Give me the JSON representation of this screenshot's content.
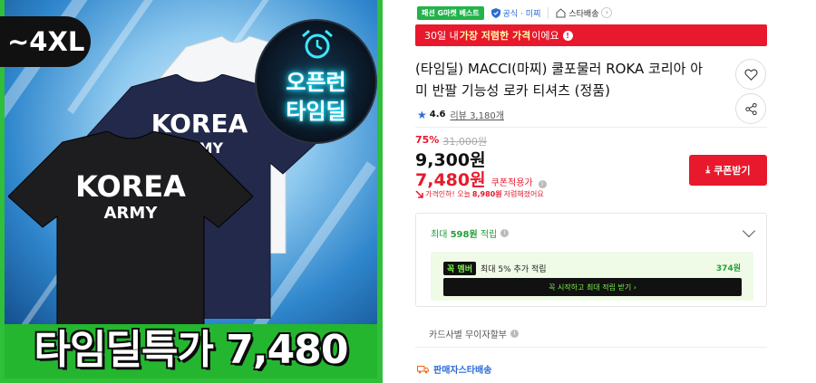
{
  "image": {
    "size_badge": "~4XL",
    "timer_badge": {
      "line1": "오픈런",
      "line2": "타임딜"
    },
    "tshirts": {
      "front_text1": "KOREA",
      "front_text2": "ARMY",
      "middle_text1": "KOREA",
      "middle_text2": "ARMY"
    },
    "deal_banner": "타임딜특가 7,480"
  },
  "badges": {
    "fashion_best": "패션 G마켓 베스트",
    "official": "공식 · 미찌",
    "star_delivery": "스타배송",
    "chevron": "›"
  },
  "price_alert": {
    "prefix": "30일 내 ",
    "highlight": "가장 저렴한 가격",
    "suffix": "이에요",
    "icon": "!"
  },
  "product": {
    "title_line1": "(타임딜) MACCI(마찌) 쿨포물러 ROKA 코리아 아",
    "title_line2": "미 반팔 기능성 로카 티셔츠 (정품)"
  },
  "rating": {
    "star": "★",
    "score": "4.6",
    "reviews": "리뷰 3,180개"
  },
  "price": {
    "discount_rate": "75%",
    "original": "31,000원",
    "sale": "9,300원",
    "coupon_price": "7,480원",
    "coupon_label": "쿠폰적용가",
    "lowest_note_prefix": "가격인하! 오늘 ",
    "lowest_note_amount": "8,980원",
    "lowest_note_suffix": " 저렴해졌어요"
  },
  "coupon_button": {
    "icon": "⤓",
    "label": "쿠폰받기"
  },
  "points": {
    "prefix": "최대 ",
    "amount": "598원",
    "suffix": " 적립",
    "member_tag_prefix": "꼭",
    "member_tag": "멤버",
    "member_text": "최대 5% 추가 적립",
    "member_points": "374원",
    "member_button": "꼭 시작하고 최대 적립 받기 ›"
  },
  "installment": "카드사별 무이자할부",
  "shipping": "판매자스타배송"
}
